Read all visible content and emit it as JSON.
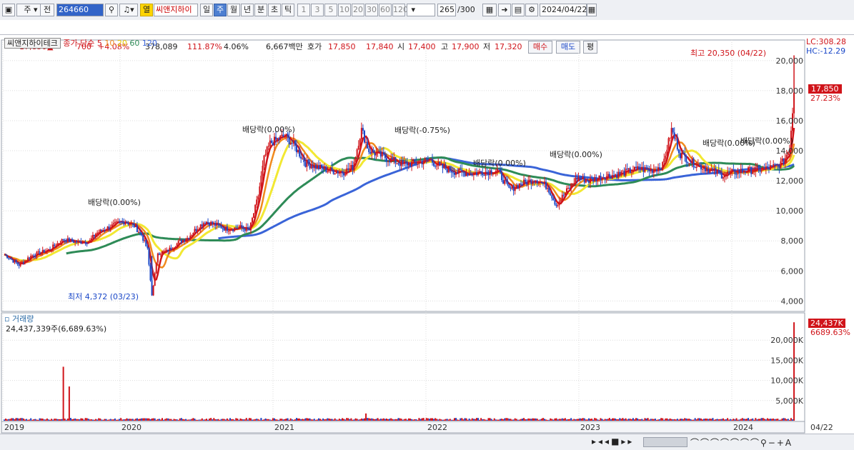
{
  "toolbar": {
    "market": "주",
    "prev": "전",
    "code": "264660",
    "mode": "열",
    "name": "씨앤지하이",
    "periods": [
      "일",
      "주",
      "월",
      "년",
      "분",
      "초",
      "틱"
    ],
    "period_selected": "주",
    "intervals": [
      "1",
      "3",
      "5",
      "10",
      "20",
      "30",
      "60",
      "120"
    ],
    "count": "265",
    "count_total": "/300",
    "date": "2024/04/22"
  },
  "quote": {
    "price": "17,850",
    "arrow": "▲",
    "change": "700",
    "change_pct": "+4.08%",
    "volume": "378,089",
    "vol_ratio": "111.87%",
    "turnover": "4.06%",
    "amount": "6,667백만",
    "ask_label": "호가",
    "ask": "17,850",
    "bid": "17,840",
    "open_label": "시",
    "open": "17,400",
    "high_label": "고",
    "high": "17,900",
    "low_label": "저",
    "low": "17,320",
    "buy_label": "매수",
    "sell_label": "매도",
    "avg_label": "평"
  },
  "price_pane": {
    "name_tag": "씨앤지하이테크",
    "ma_label": "종가 단순",
    "ma_periods": [
      "5",
      "10",
      "20",
      "60",
      "120"
    ],
    "lc": "LC:308.28",
    "hc": "HC:-12.29",
    "last_price": "17,850",
    "last_pct": "27.23%",
    "high_note": "최고 20,350 (04/22)",
    "low_note": "최저 4,372 (03/23)",
    "dividends": [
      "배당락(0.00%)",
      "배당락(0.00%)",
      "배당락(-0.75%)",
      "배당락(0.00%)",
      "배당락(0.00%)",
      "배당락(0.00%)",
      "배당락(0.00%)"
    ]
  },
  "volume_pane": {
    "title": "거래량",
    "info": "24,437,339주(6,689.63%)",
    "last_vol": "24,437K",
    "last_pct": "6689.63%"
  },
  "colors": {
    "up": "#d0141a",
    "down": "#1b48c8",
    "ma5": "#d0141a",
    "ma10": "#f08a1e",
    "ma20": "#f2e832",
    "ma60": "#2e8b57",
    "ma120": "#3a64d8"
  },
  "chart_data": {
    "type": "candlestick",
    "x_ticks": [
      "2019",
      "2020",
      "2021",
      "2022",
      "2023",
      "2024",
      "04/22"
    ],
    "y_ticks": [
      4000,
      6000,
      8000,
      10000,
      12000,
      14000,
      16000,
      18000,
      20000
    ],
    "ylim": [
      3400,
      20800
    ],
    "volume_ticks": [
      "5,000K",
      "10,000K",
      "15,000K",
      "20,000K"
    ],
    "volume_ylim": [
      0,
      25000
    ],
    "series": [
      {
        "name": "주가",
        "anchors": [
          [
            0,
            7100
          ],
          [
            10,
            6400
          ],
          [
            18,
            7000
          ],
          [
            30,
            7400
          ],
          [
            40,
            8100
          ],
          [
            50,
            7900
          ],
          [
            58,
            8000
          ],
          [
            62,
            8500
          ],
          [
            75,
            9100
          ],
          [
            82,
            9300
          ],
          [
            88,
            9000
          ],
          [
            93,
            8400
          ],
          [
            97,
            7400
          ],
          [
            100,
            4372
          ],
          [
            104,
            7200
          ],
          [
            110,
            7300
          ],
          [
            118,
            7900
          ],
          [
            124,
            8200
          ],
          [
            130,
            8800
          ],
          [
            136,
            9300
          ],
          [
            142,
            9100
          ],
          [
            150,
            8800
          ],
          [
            160,
            8900
          ],
          [
            166,
            8700
          ],
          [
            172,
            11000
          ],
          [
            176,
            13500
          ],
          [
            180,
            14500
          ],
          [
            184,
            14700
          ],
          [
            190,
            15000
          ],
          [
            196,
            14400
          ],
          [
            204,
            13200
          ],
          [
            212,
            12900
          ],
          [
            220,
            12700
          ],
          [
            230,
            12600
          ],
          [
            236,
            12900
          ],
          [
            242,
            15400
          ],
          [
            247,
            14000
          ],
          [
            252,
            13800
          ],
          [
            262,
            13400
          ],
          [
            270,
            13100
          ],
          [
            278,
            13200
          ],
          [
            288,
            13400
          ],
          [
            296,
            12900
          ],
          [
            306,
            12600
          ],
          [
            316,
            12500
          ],
          [
            326,
            12600
          ],
          [
            334,
            12700
          ],
          [
            342,
            11400
          ],
          [
            350,
            11800
          ],
          [
            360,
            12100
          ],
          [
            368,
            11600
          ],
          [
            374,
            10400
          ],
          [
            380,
            11200
          ],
          [
            388,
            12200
          ],
          [
            396,
            12000
          ],
          [
            406,
            12300
          ],
          [
            414,
            12400
          ],
          [
            422,
            12600
          ],
          [
            430,
            12800
          ],
          [
            438,
            12700
          ],
          [
            446,
            13000
          ],
          [
            452,
            15400
          ],
          [
            458,
            13800
          ],
          [
            466,
            13200
          ],
          [
            476,
            12800
          ],
          [
            486,
            12400
          ],
          [
            496,
            12600
          ],
          [
            506,
            12700
          ],
          [
            516,
            12800
          ],
          [
            524,
            13000
          ],
          [
            528,
            13300
          ],
          [
            532,
            14200
          ],
          [
            535,
            17850
          ]
        ]
      },
      {
        "name": "거래량",
        "spikes": [
          [
            40,
            13400
          ],
          [
            44,
            8500
          ],
          [
            245,
            1800
          ],
          [
            535,
            24437
          ]
        ]
      }
    ]
  }
}
